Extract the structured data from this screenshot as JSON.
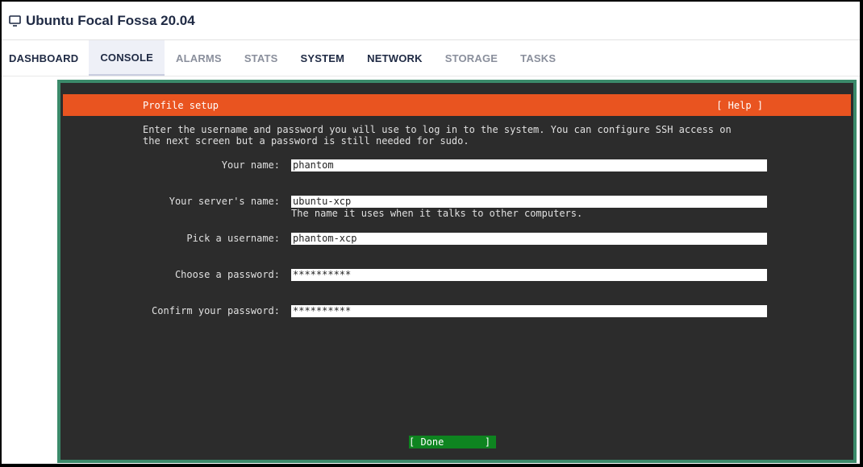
{
  "window": {
    "title": "Ubuntu Focal Fossa 20.04",
    "icon": "monitor-icon"
  },
  "tabs": [
    {
      "label": "DASHBOARD",
      "state": "normal"
    },
    {
      "label": "CONSOLE",
      "state": "active"
    },
    {
      "label": "ALARMS",
      "state": "muted"
    },
    {
      "label": "STATS",
      "state": "muted"
    },
    {
      "label": "SYSTEM",
      "state": "normal"
    },
    {
      "label": "NETWORK",
      "state": "normal"
    },
    {
      "label": "STORAGE",
      "state": "muted"
    },
    {
      "label": "TASKS",
      "state": "muted"
    }
  ],
  "console": {
    "header": {
      "title": "Profile setup",
      "help": "[ Help ]"
    },
    "intro": [
      "Enter the username and password you will use to log in to the system. You can configure SSH access on",
      "the next screen but a password is still needed for sudo."
    ],
    "fields": [
      {
        "label": "Your name:",
        "value": "phantom"
      },
      {
        "label": "Your server's name:",
        "value": "ubuntu-xcp",
        "hint": "The name it uses when it talks to other computers."
      },
      {
        "label": "Pick a username:",
        "value": "phantom-xcp"
      },
      {
        "label": "Choose a password:",
        "value": "**********"
      },
      {
        "label": "Confirm your password:",
        "value": "**********"
      }
    ],
    "done_label": "[ Done       ]"
  },
  "colors": {
    "accent_orange": "#e95420",
    "done_green": "#0e8420",
    "console_border": "#3b8a6a",
    "console_bg": "#2c2c2c"
  }
}
